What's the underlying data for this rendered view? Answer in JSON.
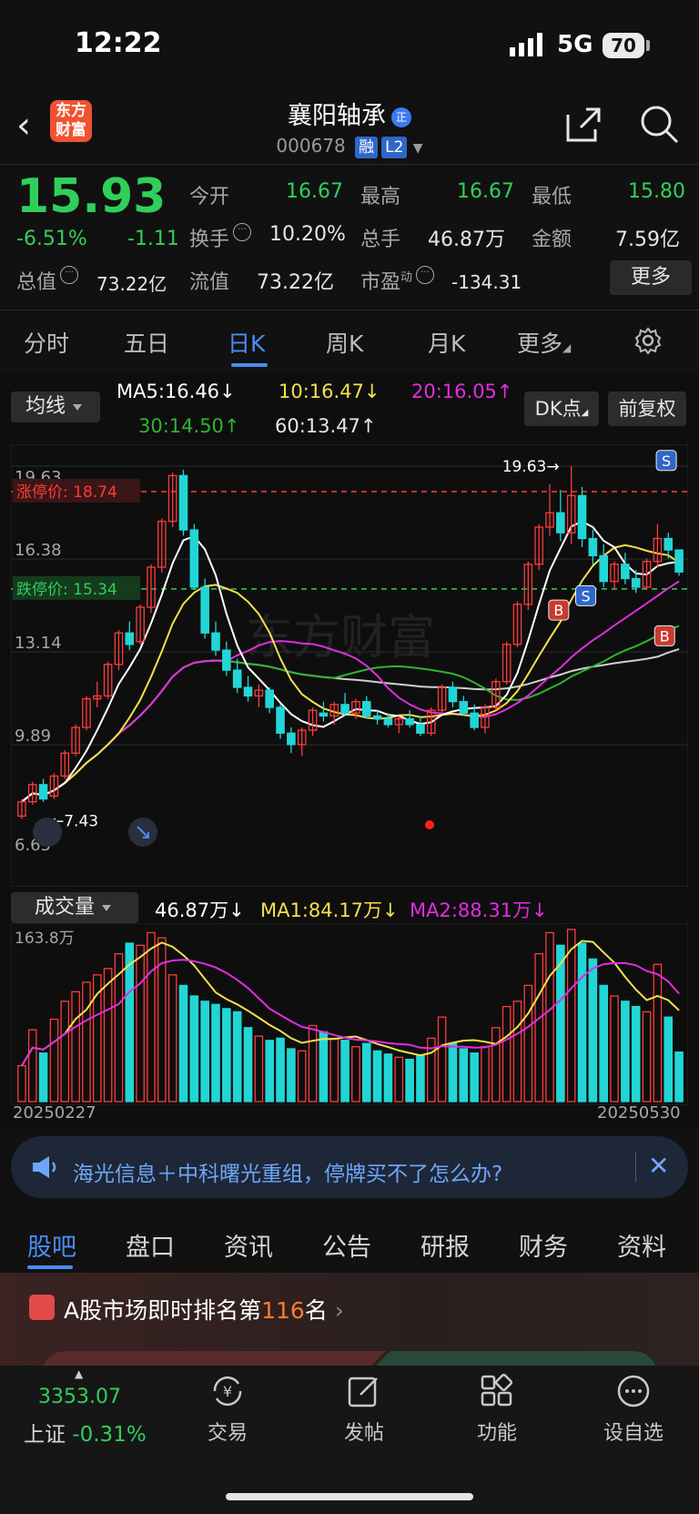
{
  "status": {
    "time": "12:22",
    "network": "5G",
    "battery": "70"
  },
  "nav": {
    "logo_text": "东方财富",
    "title": "襄阳轴承",
    "title_badge": "正",
    "code": "000678",
    "tag_margin": "融",
    "tag_level": "L2"
  },
  "quote": {
    "price": "15.93",
    "change_pct": "-6.51%",
    "change": "-1.11",
    "market_value_label": "总值",
    "market_value": "73.22亿",
    "open_label": "今开",
    "open": "16.67",
    "high_label": "最高",
    "high": "16.67",
    "low_label": "最低",
    "low": "15.80",
    "turnover_label": "换手",
    "turnover": "10.20%",
    "volume_label": "总手",
    "volume": "46.87万",
    "amount_label": "金额",
    "amount": "7.59亿",
    "float_label": "流值",
    "float_value": "73.22亿",
    "pe_label": "市盈",
    "pe_superscript": "动",
    "pe": "-134.31",
    "more_button": "更多"
  },
  "tabs": [
    "分时",
    "五日",
    "日K",
    "周K",
    "月K",
    "更多"
  ],
  "active_tab": "日K",
  "chart_controls": {
    "ma_select": "均线",
    "ma5": "MA5:16.46",
    "ma10": "10:16.47",
    "ma20": "20:16.05",
    "ma30": "30:14.50",
    "ma60": "60:13.47",
    "dk_button": "DK点",
    "adjust_button": "前复权",
    "volume_select": "成交量",
    "vol_value": "46.87万",
    "vol_ma1": "MA1:84.17万",
    "vol_ma2": "MA2:88.31万"
  },
  "chart_labels": {
    "y_top": "19.63",
    "y_2": "16.38",
    "y_3": "13.14",
    "y_4": "9.89",
    "y_low": "6.65",
    "limit_up_label": "涨停价: 18.74",
    "limit_down_label": "跌停价: 15.34",
    "high_marker": "19.63→",
    "low_marker": "←7.43",
    "vol_max": "163.8万",
    "date_start": "20250227",
    "date_end": "20250530",
    "watermark": "东方财富",
    "signal_s": "S",
    "signal_b": "B"
  },
  "colors": {
    "up": "#ff3b3b",
    "down": "#22d6d6",
    "ma5": "#ffffff",
    "ma10": "#f5e04a",
    "ma20": "#e02ee0",
    "ma30": "#2fb52f",
    "ma60": "#d0d0d0",
    "accent": "#4a8df5"
  },
  "chart_data": {
    "type": "candlestick",
    "ylim": [
      6.65,
      19.63
    ],
    "limit_up": 18.74,
    "limit_down": 15.34,
    "candles": [
      [
        7.4,
        8.0,
        7.3,
        7.9
      ],
      [
        7.9,
        8.6,
        7.8,
        8.5
      ],
      [
        8.5,
        8.7,
        7.9,
        8.0
      ],
      [
        8.1,
        8.9,
        8.0,
        8.8
      ],
      [
        8.8,
        9.7,
        8.7,
        9.6
      ],
      [
        9.6,
        10.6,
        9.5,
        10.5
      ],
      [
        10.5,
        11.6,
        10.4,
        11.5
      ],
      [
        11.5,
        12.1,
        11.2,
        11.6
      ],
      [
        11.6,
        12.8,
        11.5,
        12.7
      ],
      [
        12.7,
        13.9,
        12.5,
        13.8
      ],
      [
        13.8,
        14.2,
        13.2,
        13.4
      ],
      [
        13.5,
        14.8,
        13.4,
        14.7
      ],
      [
        14.7,
        16.2,
        14.5,
        16.1
      ],
      [
        16.1,
        17.8,
        15.9,
        17.7
      ],
      [
        17.7,
        19.4,
        17.5,
        19.3
      ],
      [
        19.3,
        19.5,
        17.2,
        17.4
      ],
      [
        17.4,
        17.6,
        15.3,
        15.4
      ],
      [
        15.4,
        15.7,
        13.6,
        13.8
      ],
      [
        13.8,
        14.2,
        13.0,
        13.2
      ],
      [
        13.2,
        13.5,
        12.3,
        12.5
      ],
      [
        12.5,
        12.9,
        11.7,
        11.9
      ],
      [
        11.9,
        12.3,
        11.4,
        11.6
      ],
      [
        11.6,
        12.0,
        11.2,
        11.8
      ],
      [
        11.8,
        11.9,
        11.0,
        11.2
      ],
      [
        11.2,
        11.3,
        10.1,
        10.3
      ],
      [
        10.3,
        10.5,
        9.6,
        9.9
      ],
      [
        9.9,
        10.5,
        9.5,
        10.4
      ],
      [
        10.4,
        11.2,
        10.2,
        11.1
      ],
      [
        11.0,
        11.4,
        10.7,
        10.9
      ],
      [
        10.9,
        11.4,
        10.6,
        11.3
      ],
      [
        11.3,
        11.7,
        10.9,
        11.0
      ],
      [
        11.0,
        11.5,
        10.8,
        11.4
      ],
      [
        11.4,
        11.6,
        10.8,
        10.9
      ],
      [
        10.9,
        11.1,
        10.6,
        10.8
      ],
      [
        10.8,
        11.0,
        10.5,
        10.6
      ],
      [
        10.6,
        10.9,
        10.3,
        10.8
      ],
      [
        10.8,
        11.1,
        10.5,
        10.6
      ],
      [
        10.6,
        10.9,
        10.2,
        10.3
      ],
      [
        10.3,
        11.2,
        10.2,
        11.1
      ],
      [
        11.1,
        12.0,
        11.0,
        11.9
      ],
      [
        11.9,
        12.1,
        11.2,
        11.4
      ],
      [
        11.4,
        11.6,
        10.9,
        11.0
      ],
      [
        11.0,
        11.3,
        10.4,
        10.5
      ],
      [
        10.5,
        11.3,
        10.3,
        11.2
      ],
      [
        11.2,
        12.2,
        11.1,
        12.1
      ],
      [
        12.1,
        13.5,
        12.0,
        13.4
      ],
      [
        13.4,
        14.9,
        13.3,
        14.8
      ],
      [
        14.8,
        16.3,
        14.6,
        16.2
      ],
      [
        16.2,
        17.6,
        16.0,
        17.5
      ],
      [
        17.5,
        19.0,
        17.2,
        18.0
      ],
      [
        18.0,
        18.8,
        17.0,
        17.3
      ],
      [
        17.3,
        19.63,
        16.9,
        18.6
      ],
      [
        18.6,
        18.9,
        16.8,
        17.1
      ],
      [
        17.1,
        17.4,
        16.2,
        16.5
      ],
      [
        16.5,
        16.9,
        15.4,
        15.6
      ],
      [
        15.6,
        16.3,
        15.3,
        16.2
      ],
      [
        16.2,
        16.6,
        15.5,
        15.7
      ],
      [
        15.7,
        16.0,
        15.2,
        15.4
      ],
      [
        15.4,
        16.4,
        15.3,
        16.3
      ],
      [
        16.3,
        17.6,
        16.1,
        17.1
      ],
      [
        17.1,
        17.3,
        16.4,
        16.7
      ],
      [
        16.7,
        16.67,
        15.8,
        15.93
      ]
    ],
    "volume_ylim": [
      0,
      163.8
    ],
    "volume": [
      34,
      68,
      46,
      78,
      95,
      104,
      113,
      120,
      126,
      140,
      150,
      148,
      160,
      155,
      120,
      110,
      100,
      95,
      92,
      88,
      85,
      70,
      62,
      58,
      60,
      50,
      48,
      72,
      66,
      60,
      58,
      52,
      55,
      48,
      45,
      42,
      40,
      44,
      60,
      80,
      55,
      50,
      46,
      52,
      70,
      90,
      95,
      110,
      140,
      160,
      148,
      163,
      150,
      135,
      110,
      100,
      95,
      90,
      85,
      130,
      80,
      46.87
    ]
  },
  "banner": {
    "text": "海光信息＋中科曙光重组，停牌买不了怎么办?"
  },
  "section_tabs": [
    "股吧",
    "盘口",
    "资讯",
    "公告",
    "研报",
    "财务",
    "资料"
  ],
  "rank": {
    "prefix": "A股市场即时排名第",
    "number": "116",
    "suffix": "名"
  },
  "bottom_bar": {
    "index_value": "3353.07",
    "index_name": "上证",
    "index_change": "-0.31%",
    "items": [
      "交易",
      "发帖",
      "功能",
      "设自选"
    ]
  }
}
